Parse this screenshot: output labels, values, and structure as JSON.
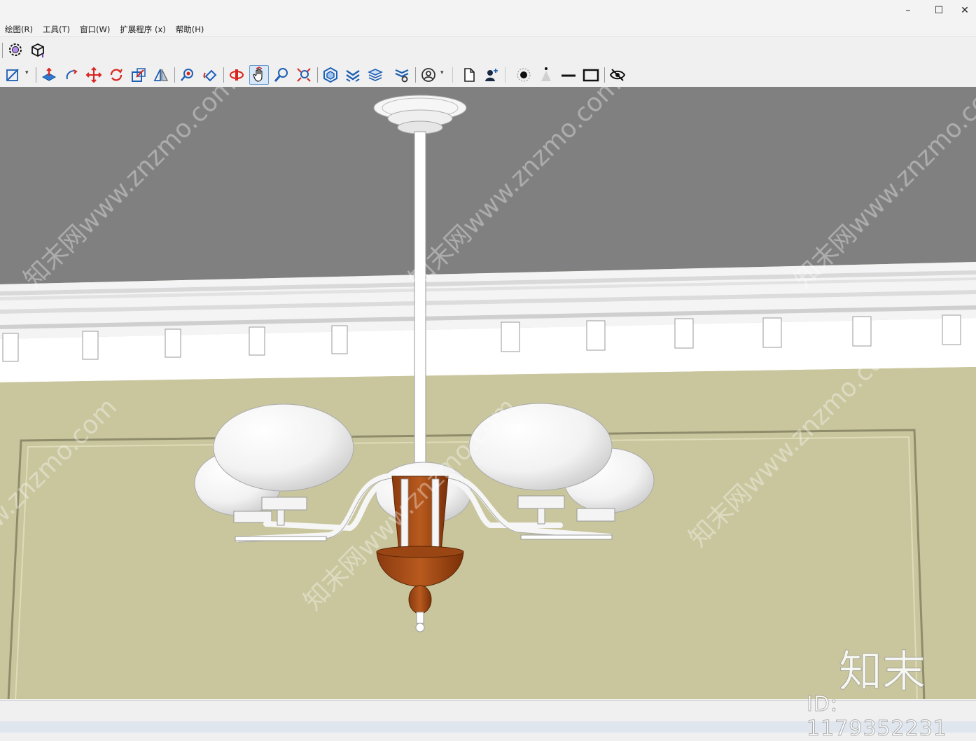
{
  "window": {
    "controls": {
      "minimize": "–",
      "maximize": "☐",
      "close": "✕"
    }
  },
  "menu": [
    "绘图(R)",
    "工具(T)",
    "窗口(W)",
    "扩展程序 (x)",
    "帮助(H)"
  ],
  "toolbar_row1": [
    {
      "name": "extension-settings-icon"
    },
    {
      "name": "component-box-icon"
    }
  ],
  "toolbar_row2": [
    {
      "name": "line-tool-icon"
    },
    {
      "name": "push-pull-icon"
    },
    {
      "name": "follow-me-icon"
    },
    {
      "name": "move-icon"
    },
    {
      "name": "rotate-icon"
    },
    {
      "name": "scale-icon"
    },
    {
      "name": "flip-icon"
    },
    {
      "name": "tape-measure-icon"
    },
    {
      "name": "paint-bucket-icon"
    },
    {
      "name": "orbit-icon"
    },
    {
      "name": "pan-icon",
      "active": true
    },
    {
      "name": "zoom-icon"
    },
    {
      "name": "zoom-extents-icon"
    },
    {
      "name": "components-panel-icon"
    },
    {
      "name": "materials-icon"
    },
    {
      "name": "layers-icon"
    },
    {
      "name": "styles-icon"
    },
    {
      "name": "account-icon"
    },
    {
      "name": "new-document-icon"
    },
    {
      "name": "add-user-icon"
    },
    {
      "name": "shadow-point-icon"
    },
    {
      "name": "cone-icon"
    },
    {
      "name": "line-segment-icon"
    },
    {
      "name": "rectangle-icon"
    },
    {
      "name": "hide-icon"
    }
  ],
  "watermarks": {
    "diagonal": "知末网www.znzmo.com",
    "logo": "知末",
    "id": "ID: 1179352231"
  },
  "colors": {
    "ceiling": "#808080",
    "wall": "#c9c69e",
    "wood": "#a24a14",
    "accent_active": "#d9e8f8"
  }
}
